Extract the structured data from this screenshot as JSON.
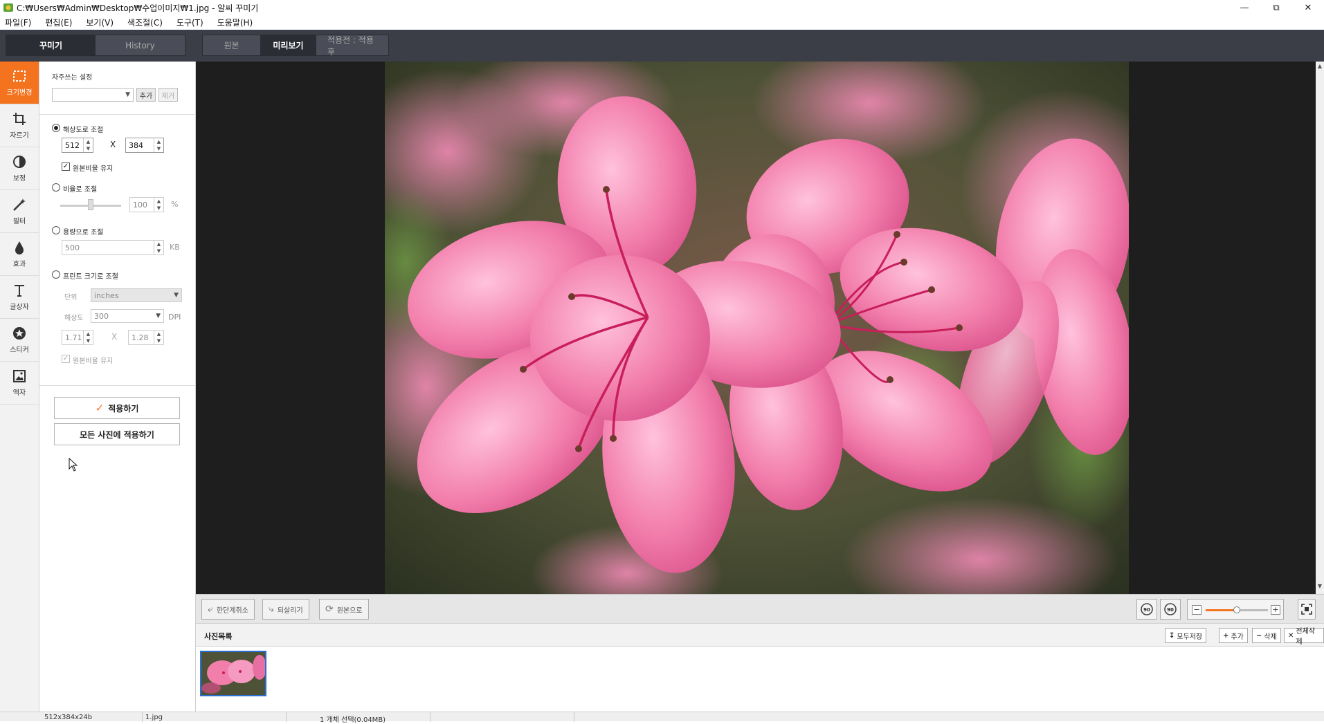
{
  "window": {
    "title": "C:₩Users₩Admin₩Desktop₩수업이미지₩1.jpg - 알씨 꾸미기",
    "controls": [
      "minimize-icon",
      "restore-icon",
      "close-icon"
    ]
  },
  "menu": [
    "파일(F)",
    "편집(E)",
    "보기(V)",
    "색조절(C)",
    "도구(T)",
    "도움말(H)"
  ],
  "left_tabs": {
    "decorate": "꾸미기",
    "history": "History"
  },
  "view_tabs": {
    "original": "원본",
    "preview": "미리보기",
    "compare": "적용전 : 적용후"
  },
  "rail": [
    {
      "label": "크기변경",
      "icon": "resize-icon",
      "active": true
    },
    {
      "label": "자르기",
      "icon": "crop-icon",
      "active": false
    },
    {
      "label": "보정",
      "icon": "contrast-icon",
      "active": false
    },
    {
      "label": "필터",
      "icon": "magic-wand-icon",
      "active": false
    },
    {
      "label": "효과",
      "icon": "drop-icon",
      "active": false
    },
    {
      "label": "글상자",
      "icon": "text-icon",
      "active": false
    },
    {
      "label": "스티커",
      "icon": "sticker-icon",
      "active": false
    },
    {
      "label": "액자",
      "icon": "frame-icon",
      "active": false
    }
  ],
  "panel": {
    "favorites_label": "자주쓰는 설정",
    "favorites_value": "",
    "add_label": "추가",
    "remove_label": "제거",
    "resolution": {
      "label": "해상도로 조절",
      "selected": true,
      "width": "512",
      "height": "384",
      "x": "X",
      "keep_ratio_label": "원본비율 유지",
      "keep_ratio": true
    },
    "ratio": {
      "label": "비율로 조절",
      "selected": false,
      "value": "100",
      "unit": "%",
      "slider_level": 0.5
    },
    "filesize": {
      "label": "용량으로 조절",
      "selected": false,
      "value": "500",
      "unit": "KB"
    },
    "print": {
      "label": "프린트 크기로 조절",
      "selected": false,
      "unit_label": "단위",
      "unit_value": "inches",
      "dpi_label": "해상도",
      "dpi_value": "300",
      "dpi_unit": "DPI",
      "width": "1.71",
      "height": "1.28",
      "x": "X",
      "keep_ratio_label": "원본비율 유지",
      "keep_ratio": true
    },
    "apply_label": "적용하기",
    "apply_all_label": "모든 사진에 적용하기"
  },
  "bottom": {
    "undo_label": "한단계취소",
    "redo_label": "되살리기",
    "revert_label": "원본으로",
    "rotate_left": "90",
    "rotate_right": "90",
    "zoom_minus": "−",
    "zoom_plus": "+",
    "zoom_level": 0.5
  },
  "photo_list": {
    "title": "사진목록",
    "save_all": "모두저장",
    "add": "추가",
    "delete": "삭제",
    "delete_all": "전체삭제"
  },
  "status": {
    "dims": "512x384x24b",
    "file": "1.jpg",
    "selection": "1 개체 선택(0.04MB)"
  },
  "colors": {
    "accent": "#f4731f",
    "topbar": "#3b3e47",
    "preview_bg": "#1e1e1e",
    "thumb_border": "#2a6fd6"
  }
}
